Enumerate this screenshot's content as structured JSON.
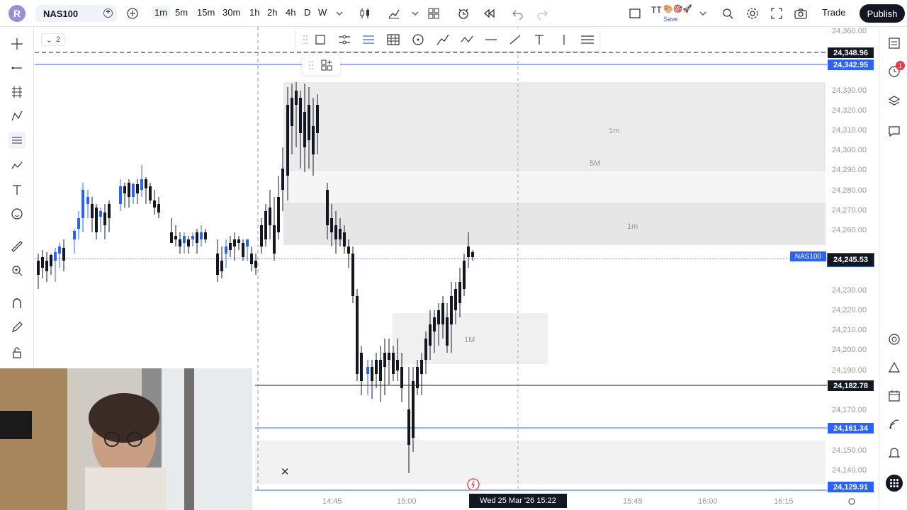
{
  "app": {
    "logo_letter": "R"
  },
  "symbol": {
    "name": "NAS100",
    "chart_label": "NAS100"
  },
  "intervals": [
    "1m",
    "5m",
    "15m",
    "30m",
    "1h",
    "2h",
    "4h",
    "D",
    "W"
  ],
  "active_interval": "1m",
  "top_right": {
    "tt_label": "TT",
    "save_label": "Save",
    "trade_label": "Trade",
    "publish_label": "Publish"
  },
  "alerts_badge": "1",
  "interval_mini": "2",
  "price_ticks": [
    "24,360.00",
    "24,330.00",
    "24,320.00",
    "24,310.00",
    "24,300.00",
    "24,290.00",
    "24,280.00",
    "24,270.00",
    "24,260.00",
    "24,230.00",
    "24,220.00",
    "24,210.00",
    "24,200.00",
    "24,190.00",
    "24,170.00",
    "24,150.00",
    "24,140.00"
  ],
  "price_tags": {
    "dashed_level": "24,348.96",
    "blue_level": "24,342.95",
    "current": "24,245.53",
    "black_level": "24,182.78",
    "blue_level_2": "24,161.34",
    "bottom_level": "24,129.91"
  },
  "time_ticks": [
    "14:45",
    "15:00",
    "15:45",
    "16:00",
    "16:15"
  ],
  "crosshair_time": "Wed 25 Mar '26   15:22",
  "zone_labels": [
    "1m",
    "5M",
    "1m",
    "1M"
  ],
  "colors": {
    "accent": "#2962ff",
    "candle_up": "#2962ff",
    "candle_down": "#131722",
    "zone": "#ebebeb",
    "dark_tag": "#131722"
  },
  "icons": {
    "left": [
      "crosshair-icon",
      "trend-line-icon",
      "fib-grid-icon",
      "pattern-icon",
      "forecast-icon",
      "brush-icon",
      "text-icon",
      "emoji-icon",
      "ruler-icon",
      "zoom-icon",
      "magnet-icon",
      "lock-drawing-icon",
      "lock-icon"
    ],
    "right": [
      "watchlist-icon",
      "alerts-clock-icon",
      "layers-icon",
      "chat-icon",
      "target-icon",
      "triangle-icon",
      "calendar-icon",
      "signal-icon",
      "bell-icon",
      "apps-icon"
    ],
    "drawbar": [
      "drag-handle-icon",
      "rectangle-icon",
      "channel-icon",
      "parallel-channel-icon",
      "grid-icon",
      "circle-icon",
      "path-icon",
      "zigzag-icon",
      "horizontal-line-icon",
      "ray-icon",
      "text-tool-icon",
      "vertical-line-icon",
      "menu-icon"
    ]
  }
}
